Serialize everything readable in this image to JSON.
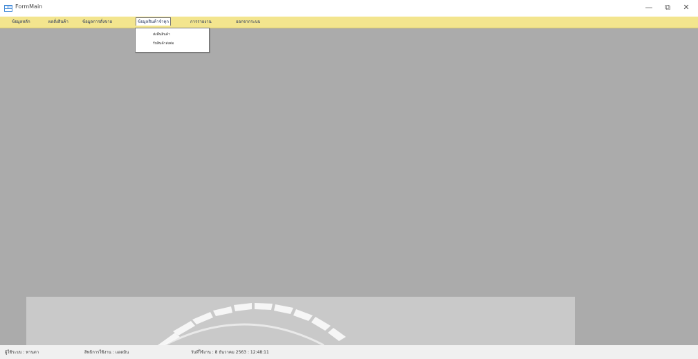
{
  "window": {
    "title": "FormMain",
    "minimize_glyph": "—",
    "restore_glyph": "⧉",
    "close_glyph": "✕",
    "icon": "app-window-icon"
  },
  "menu": {
    "items": [
      {
        "label": "ข้อมูลหลัก"
      },
      {
        "label": "ผลสั่งสินค้า"
      },
      {
        "label": "ข้อมูลการสั่งขาย"
      },
      {
        "label": "ข้อมูลสินค้าจำคุก"
      },
      {
        "label": "การรายงาน"
      },
      {
        "label": "ออกจากระบบ"
      }
    ],
    "open_dropdown": {
      "items": [
        {
          "label": "ส่งคืนสินค้า"
        },
        {
          "label": "รับสินค้าส่งต่อ"
        }
      ]
    }
  },
  "status": {
    "user": "ผู้ใช้ระบบ : ทานตา",
    "role": "สิทธิการใช้งาน : แอดมิน",
    "date": "วันที่ใช้งาน : 8 ธันวาคม 2563 : 12:48:11"
  },
  "colors": {
    "menubar": "#f3e58e",
    "mdi_background": "#ababab"
  }
}
